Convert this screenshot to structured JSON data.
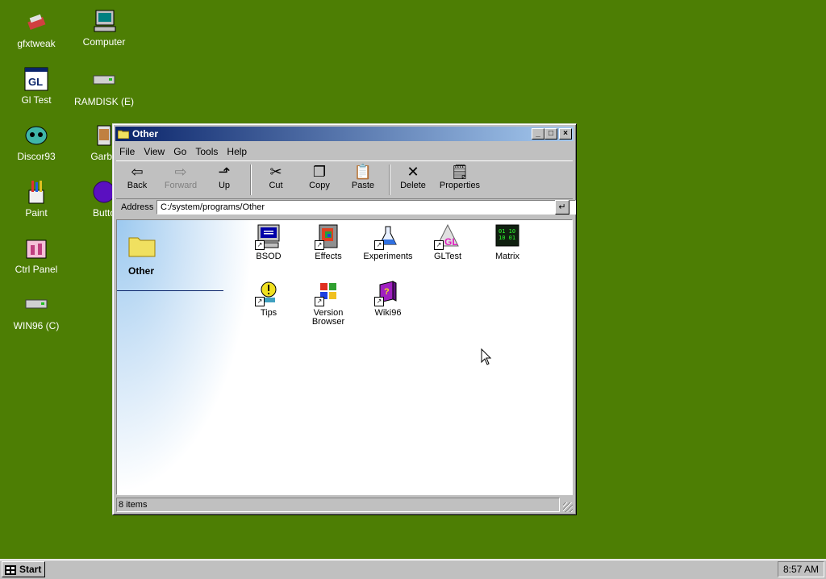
{
  "desktop": {
    "icons": [
      {
        "label": "gfxtweak",
        "icon": "gfxtweak-icon"
      },
      {
        "label": "Computer",
        "icon": "computer-icon"
      },
      {
        "label": "Gl Test",
        "icon": "gltest-icon"
      },
      {
        "label": "RAMDISK (E)",
        "icon": "drive-icon"
      },
      {
        "label": "Discor93",
        "icon": "discord-icon"
      },
      {
        "label": "Garbe",
        "icon": "garbage-icon"
      },
      {
        "label": "Paint",
        "icon": "paint-icon"
      },
      {
        "label": "Butto",
        "icon": "button-icon"
      },
      {
        "label": "Ctrl Panel",
        "icon": "control-panel-icon"
      },
      {
        "label": "WIN96 (C)",
        "icon": "drive-icon"
      }
    ]
  },
  "window": {
    "title": "Other",
    "menu": [
      "File",
      "View",
      "Go",
      "Tools",
      "Help"
    ],
    "toolbar": {
      "back": "Back",
      "forward": "Forward",
      "up": "Up",
      "cut": "Cut",
      "copy": "Copy",
      "paste": "Paste",
      "delete": "Delete",
      "properties": "Properties"
    },
    "address": {
      "label": "Address",
      "value": "C:/system/programs/Other"
    },
    "pane_title": "Other",
    "files": [
      {
        "name": "BSOD",
        "icon": "bsod-icon"
      },
      {
        "name": "Effects",
        "icon": "effects-icon"
      },
      {
        "name": "Experiments",
        "icon": "flask-icon"
      },
      {
        "name": "GLTest",
        "icon": "gltest-icon"
      },
      {
        "name": "Matrix",
        "icon": "matrix-icon"
      },
      {
        "name": "Tips",
        "icon": "tips-icon"
      },
      {
        "name": "Version Browser",
        "icon": "windows-logo-icon"
      },
      {
        "name": "Wiki96",
        "icon": "book-icon"
      }
    ],
    "status": "8 items"
  },
  "taskbar": {
    "start_label": "Start",
    "clock": "8:57 AM"
  },
  "colors": {
    "desktop": "#4d7e04",
    "titlebar_start": "#0a246a",
    "titlebar_end": "#a6caf0",
    "face": "#c0c0c0"
  }
}
